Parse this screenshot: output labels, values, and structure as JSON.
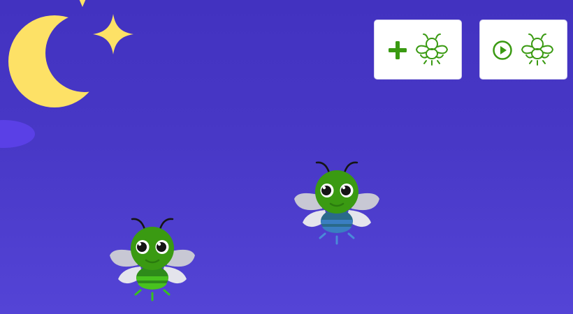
{
  "scene": {
    "sky_top_color": "#4232c0",
    "sky_bottom_color": "#5444d6",
    "moon_color": "#fde166",
    "star_color": "#fde166",
    "cloud_color": "#5a40e6"
  },
  "toolbar": {
    "accent_color": "#3a9a12",
    "buttons": [
      {
        "name": "add-firefly-button",
        "icons": [
          "plus-icon",
          "firefly-icon"
        ]
      },
      {
        "name": "play-fireflies-button",
        "icons": [
          "play-circle-icon",
          "firefly-icon"
        ]
      }
    ]
  },
  "fireflies": [
    {
      "name": "firefly-1",
      "head_color": "#3a9a12",
      "abdomen_colors": [
        "#2e8b1a",
        "#48c21e"
      ],
      "glow_color": "#38c020"
    },
    {
      "name": "firefly-2",
      "head_color": "#3a9a12",
      "abdomen_colors": [
        "#2a6a8a",
        "#3a7ec2"
      ],
      "glow_color": "#4a8ad8"
    }
  ]
}
